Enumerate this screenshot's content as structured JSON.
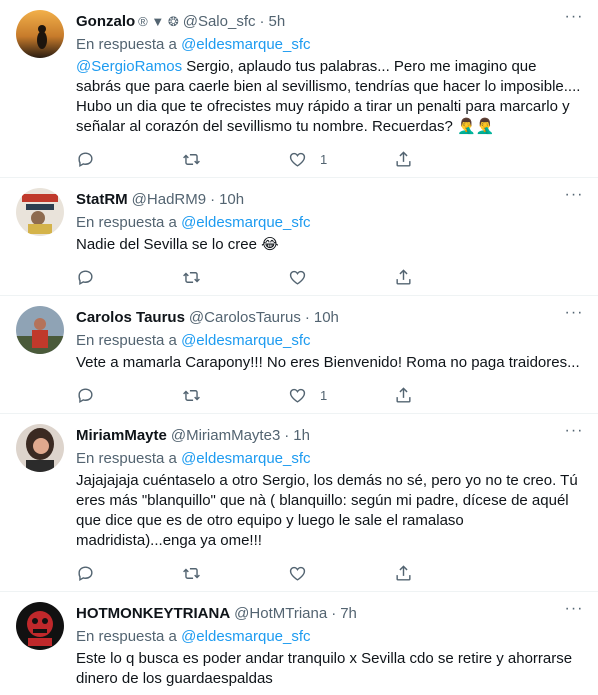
{
  "reply_prefix": "En respuesta a",
  "tweets": [
    {
      "name": "Gonzalo",
      "badges": "® ▼ ❂",
      "handle": "@Salo_sfc",
      "dot": "·",
      "time": "5h",
      "reply_to": "@eldesmarque_sfc",
      "mention": "@SergioRamos",
      "text": " Sergio, aplaudo tus palabras... Pero me imagino que sabrás que para caerle bien al sevillismo, tendrías que hacer lo imposible.... Hubo un dia que te ofrecistes muy rápido a tirar un penalti para marcarlo y señalar al corazón del sevillismo tu nombre. Recuerdas?",
      "emoji": "🤦‍♂️🤦‍♂️",
      "reply_count": "",
      "retweet_count": "",
      "like_count": "1"
    },
    {
      "name": "StatRM",
      "handle": "@HadRM9",
      "dot": "·",
      "time": "10h",
      "reply_to": "@eldesmarque_sfc",
      "text": "Nadie del Sevilla se lo cree",
      "emoji": "😂",
      "reply_count": "",
      "retweet_count": "",
      "like_count": ""
    },
    {
      "name": "Carolos Taurus",
      "handle": "@CarolosTaurus",
      "dot": "·",
      "time": "10h",
      "reply_to": "@eldesmarque_sfc",
      "text": "Vete a mamarla Carapony!!! No eres Bienvenido! Roma no paga traidores...",
      "reply_count": "",
      "retweet_count": "",
      "like_count": "1"
    },
    {
      "name": "MiriamMayte",
      "handle": "@MiriamMayte3",
      "dot": "·",
      "time": "1h",
      "reply_to": "@eldesmarque_sfc",
      "text": "Jajajajaja cuéntaselo a otro Sergio, los demás no sé, pero yo no te creo. Tú eres más \"blanquillo\" que nà ( blanquillo: según mi padre, dícese de aquél que dice que es de otro equipo y luego le sale el ramalaso madridista)...enga ya ome!!!",
      "reply_count": "",
      "retweet_count": "",
      "like_count": ""
    },
    {
      "name": "HOTMONKEYTRIANA",
      "handle": "@HotMTriana",
      "dot": "·",
      "time": "7h",
      "reply_to": "@eldesmarque_sfc",
      "text": "Este lo q busca es poder andar tranquilo x Sevilla cdo se retire y ahorrarse dinero de los guardaespaldas"
    }
  ],
  "colors": {
    "link": "#1d9bf0",
    "muted": "#536471",
    "text": "#0f1419",
    "divider": "#eff3f4"
  },
  "icons": [
    "reply-icon",
    "retweet-icon",
    "like-icon",
    "share-icon",
    "more-icon"
  ]
}
